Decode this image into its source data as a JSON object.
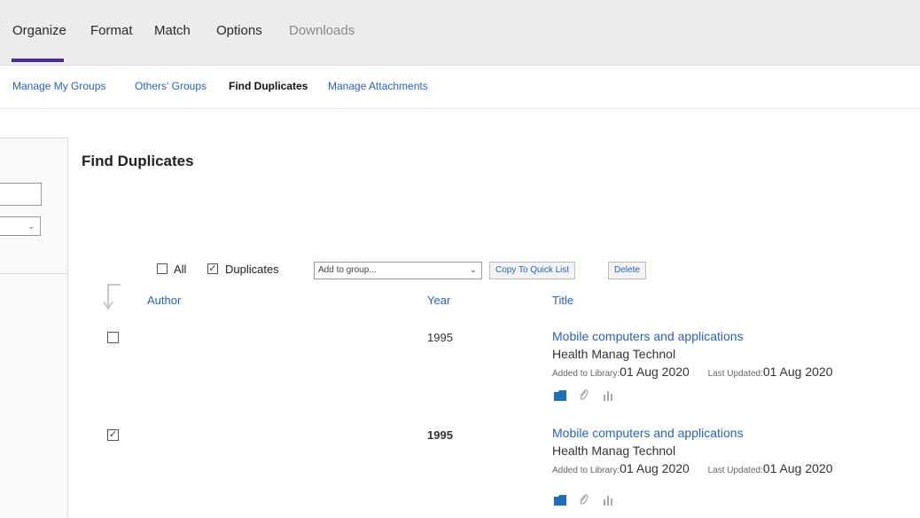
{
  "top_nav": {
    "tabs": [
      {
        "label": "Organize"
      },
      {
        "label": "Format"
      },
      {
        "label": "Match"
      },
      {
        "label": "Options"
      },
      {
        "label": "Downloads"
      }
    ]
  },
  "sub_nav": {
    "links": [
      {
        "label": "Manage My Groups"
      },
      {
        "label": "Others' Groups"
      },
      {
        "label": "Find Duplicates"
      },
      {
        "label": "Manage Attachments"
      }
    ]
  },
  "main": {
    "title": "Find Duplicates",
    "toolbar": {
      "all_label": "All",
      "duplicates_label": "Duplicates",
      "group_select_value": "Add to group...",
      "copy_button": "Copy To Quick List",
      "delete_button": "Delete"
    },
    "columns": {
      "author": "Author",
      "year": "Year",
      "title": "Title"
    },
    "rows": [
      {
        "checked": false,
        "year": "1995",
        "title": "Mobile computers and applications",
        "journal": "Health Manag Technol",
        "added_label": "Added to Library:",
        "added_date": "01 Aug 2020",
        "updated_label": "Last Updated:",
        "updated_date": "01 Aug 2020"
      },
      {
        "checked": true,
        "year": "1995",
        "title": "Mobile computers and applications",
        "journal": "Health Manag Technol",
        "added_label": "Added to Library:",
        "added_date": "01 Aug 2020",
        "updated_label": "Last Updated:",
        "updated_date": "01 Aug 2020"
      }
    ]
  },
  "icons": [
    "folder-icon",
    "paperclip-icon",
    "bar-chart-icon",
    "chevron-down-icon"
  ],
  "colors": {
    "accent": "#4b2c8f",
    "link": "#2b62b6",
    "folder": "#1e6fb8"
  }
}
